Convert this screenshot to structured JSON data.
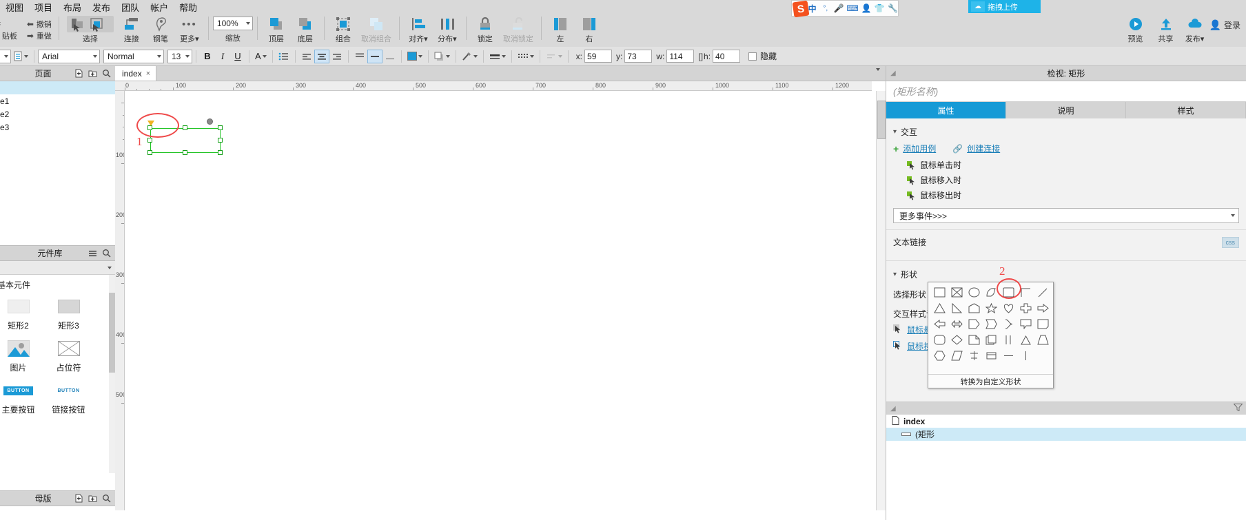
{
  "menu": {
    "items": [
      "视图",
      "项目",
      "布局",
      "发布",
      "团队",
      "帐户",
      "帮助"
    ]
  },
  "toolbar": {
    "clipboard_label": "贴板",
    "undo_label": "撤销",
    "redo_label": "重做",
    "cut_icon": "scissors-icon",
    "copy_icon": "copy-icon",
    "select_label": "选择",
    "connect_label": "连接",
    "pen_label": "钢笔",
    "more_label": "更多",
    "zoom_value": "100%",
    "zoom_label": "缩放",
    "front_label": "顶层",
    "back_label": "底层",
    "group_label": "组合",
    "ungroup_label": "取消组合",
    "align_label": "对齐",
    "distribute_label": "分布",
    "lock_label": "锁定",
    "unlock_label": "取消锁定",
    "left_label": "左",
    "right_label": "右",
    "preview_label": "预览",
    "share_label": "共享",
    "publish_label": "发布",
    "account_label": "登录"
  },
  "format": {
    "font_family": "Arial",
    "font_style": "Normal",
    "font_size": "13",
    "bold": "B",
    "italic": "I",
    "underline": "U",
    "font_color_icon": "font-color-icon",
    "list_icon": "bullet-list-icon",
    "align_left_icon": "align-left-icon",
    "align_center_icon": "align-center-icon",
    "align_right_icon": "align-right-icon",
    "valign_top_icon": "valign-top-icon",
    "valign_middle_icon": "valign-middle-icon",
    "valign_bottom_icon": "valign-bottom-icon",
    "fill_icon": "fill-color-icon",
    "shadow_icon": "shadow-icon",
    "line_icon": "line-color-icon",
    "line_width_icon": "line-width-icon",
    "line_style_icon": "line-style-icon",
    "arrow_icon": "arrow-style-icon",
    "x_label": "x:",
    "x_value": "59",
    "y_label": "y:",
    "y_value": "73",
    "w_label": "w:",
    "w_value": "114",
    "h_label": "h:",
    "h_value": "40",
    "hide_label": "隐藏"
  },
  "ime": {
    "logo": "S",
    "mode": "中",
    "punct": "°,",
    "mic_icon": "microphone-icon",
    "keyboard_icon": "keyboard-icon",
    "user_icon": "user-icon",
    "skin_icon": "tshirt-icon",
    "tools_icon": "wrench-icon"
  },
  "drag_upload": {
    "label": "拖拽上传",
    "icon": "cloud-upload-icon"
  },
  "pages_panel": {
    "title": "页面",
    "add_page_icon": "add-page-icon",
    "add_folder_icon": "add-folder-icon",
    "search_icon": "search-icon",
    "items": [
      {
        "label": "",
        "selected": true
      },
      {
        "label": "e1",
        "selected": false
      },
      {
        "label": "e2",
        "selected": false
      },
      {
        "label": "e3",
        "selected": false
      }
    ]
  },
  "library_panel": {
    "title": "元件库",
    "menu_icon": "hamburger-icon",
    "search_icon": "search-icon",
    "category": "基本元件",
    "items": [
      {
        "label": "矩形2",
        "icon": "rectangle2-icon"
      },
      {
        "label": "矩形3",
        "icon": "rectangle3-icon"
      },
      {
        "label": "图片",
        "icon": "image-icon"
      },
      {
        "label": "占位符",
        "icon": "placeholder-icon"
      },
      {
        "label": "主要按钮",
        "icon": "primary-button-icon"
      },
      {
        "label": "链接按钮",
        "icon": "link-button-icon"
      }
    ],
    "button_text": "BUTTON"
  },
  "masters_panel": {
    "title": "母版",
    "add_master_icon": "add-master-icon",
    "add_folder_icon": "add-folder-icon",
    "search_icon": "search-icon"
  },
  "canvas": {
    "tab_label": "index",
    "tab_close": "×",
    "ruler_h_marks": [
      "0",
      "100",
      "200",
      "300",
      "400",
      "500",
      "600",
      "700",
      "800",
      "900",
      "1000",
      "1100",
      "1200"
    ],
    "ruler_v_marks": [
      "100",
      "200",
      "300",
      "400",
      "500"
    ],
    "annotations": [
      {
        "number": "1"
      },
      {
        "number": "2"
      }
    ]
  },
  "inspector": {
    "header_title": "检视: 矩形",
    "name_placeholder": "(矩形名称)",
    "tabs": [
      {
        "label": "属性",
        "active": true
      },
      {
        "label": "说明",
        "active": false
      },
      {
        "label": "样式",
        "active": false
      }
    ],
    "interaction": {
      "section_title": "交互",
      "add_case_label": "添加用例",
      "create_link_label": "创建连接",
      "events": [
        "鼠标单击时",
        "鼠标移入时",
        "鼠标移出时"
      ],
      "more_events_label": "更多事件>>>"
    },
    "text_link": {
      "label": "文本链接",
      "fx_label": "css"
    },
    "shape": {
      "section_title": "形状",
      "select_shape_label": "选择形状",
      "interaction_style_label": "交互样式设",
      "hover_label": "鼠标悬停",
      "mousedown_label": "鼠标按下"
    }
  },
  "shape_picker": {
    "convert_label": "转换为自定义形状",
    "shapes": [
      "rectangle",
      "rect-x",
      "ellipse",
      "droplet",
      "rounded-rect-selected",
      "corner-bracket",
      "arc",
      "triangle",
      "right-triangle",
      "pentagon-up",
      "star",
      "heart",
      "plus",
      "arrow-right",
      "arrow-left",
      "arrow-lr",
      "tab-right",
      "flag",
      "bracket-right",
      "callout",
      "parallelogram-note",
      "rounded-rect",
      "diamond",
      "page-fold",
      "document",
      "pipes",
      "triangle-sm",
      "trapezoid",
      "hexagon",
      "slanted",
      "flag-pole",
      "cylinder",
      "dash",
      "bar"
    ]
  },
  "outline": {
    "corner_icon": "resize-corner-icon",
    "rows": [
      {
        "label": "index",
        "icon": "page-icon",
        "selected": false,
        "child": false
      },
      {
        "label": "(矩形",
        "icon": "rect-icon",
        "selected": true,
        "child": true
      }
    ]
  }
}
